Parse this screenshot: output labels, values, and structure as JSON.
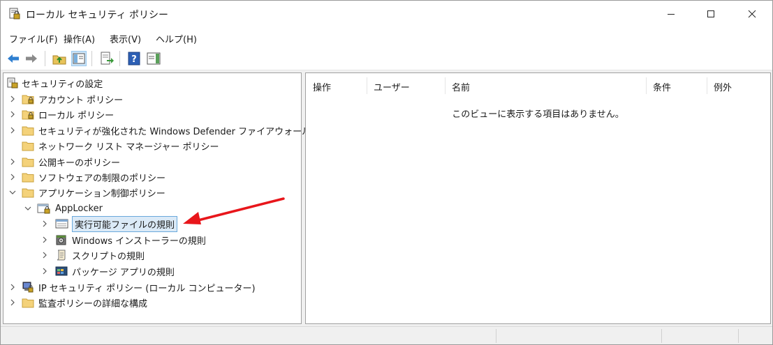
{
  "window": {
    "title": "ローカル セキュリティ ポリシー"
  },
  "menu": [
    "ファイル(F)",
    "操作(A)",
    "表示(V)",
    "ヘルプ(H)"
  ],
  "toolbar": {
    "buttons": [
      "back-icon",
      "forward-icon",
      "up-folder-icon",
      "show-hide-tree-icon",
      "export-list-icon",
      "help-icon",
      "show-hide-action-pane-icon"
    ]
  },
  "tree": {
    "root": "セキュリティの設定",
    "items": [
      "アカウント ポリシー",
      "ローカル ポリシー",
      "セキュリティが強化された Windows Defender ファイアウォール",
      "ネットワーク リスト マネージャー ポリシー",
      "公開キーのポリシー",
      "ソフトウェアの制限のポリシー",
      "アプリケーション制御ポリシー",
      "AppLocker",
      "実行可能ファイルの規則",
      "Windows インストーラーの規則",
      "スクリプトの規則",
      "パッケージ アプリの規則",
      "IP セキュリティ ポリシー (ローカル コンピューター)",
      "監査ポリシーの詳細な構成"
    ]
  },
  "list": {
    "columns": [
      "操作",
      "ユーザー",
      "名前",
      "条件",
      "例外"
    ],
    "empty_message": "このビューに表示する項目はありません。"
  },
  "annotation": {
    "arrow_color": "#e8161b"
  }
}
